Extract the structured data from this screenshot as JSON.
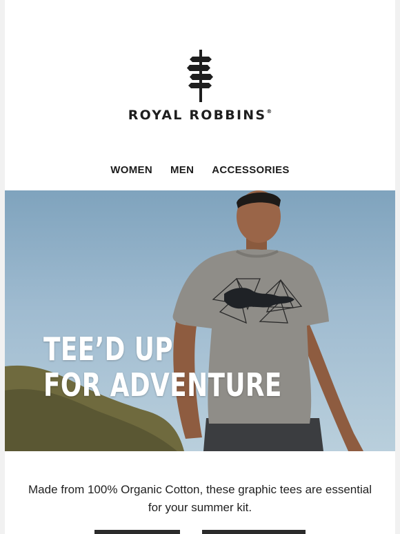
{
  "brand": {
    "name": "ROYAL ROBBINS",
    "trademark": "®"
  },
  "nav": {
    "items": [
      {
        "label": "WOMEN"
      },
      {
        "label": "MEN"
      },
      {
        "label": "ACCESSORIES"
      }
    ]
  },
  "hero": {
    "headline_line1": "TEE’D UP",
    "headline_line2": "FOR ADVENTURE"
  },
  "body_copy": "Made from 100% Organic Cotton, these graphic tees are essential for your summer kit.",
  "icons": [
    "signpost-logo-icon"
  ],
  "colors": {
    "text": "#1c1c1c",
    "cta_background": "#2b2b2b",
    "headline": "#ffffff"
  }
}
